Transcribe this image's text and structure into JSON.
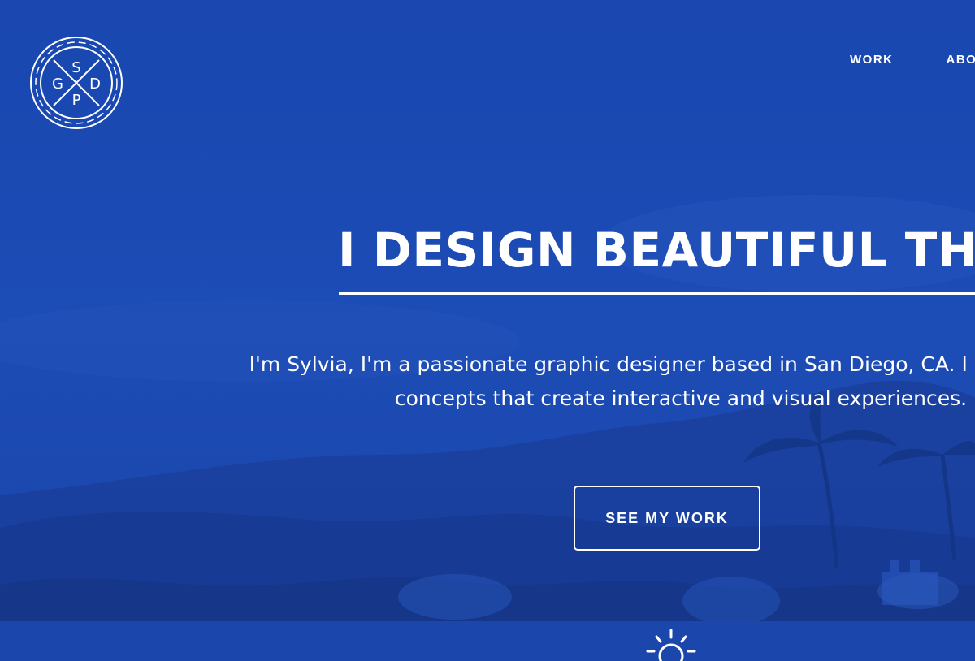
{
  "brand": {
    "logo_letters": {
      "top": "S",
      "left": "G",
      "right": "D",
      "bottom": "P"
    },
    "background_color": "#1a47b0",
    "text_color": "#ffffff"
  },
  "nav": {
    "items": [
      {
        "label": "WORK"
      },
      {
        "label": "ABOUT"
      }
    ]
  },
  "hero": {
    "headline": "I DESIGN BEAUTIFUL THINGS",
    "intro_line1": "I'm Sylvia, I'm a passionate graphic designer based in San Diego, CA. I communicate",
    "intro_line2": "concepts that create interactive and visual experiences.",
    "cta_label": "SEE MY WORK",
    "footer_icon": "sun-icon"
  }
}
